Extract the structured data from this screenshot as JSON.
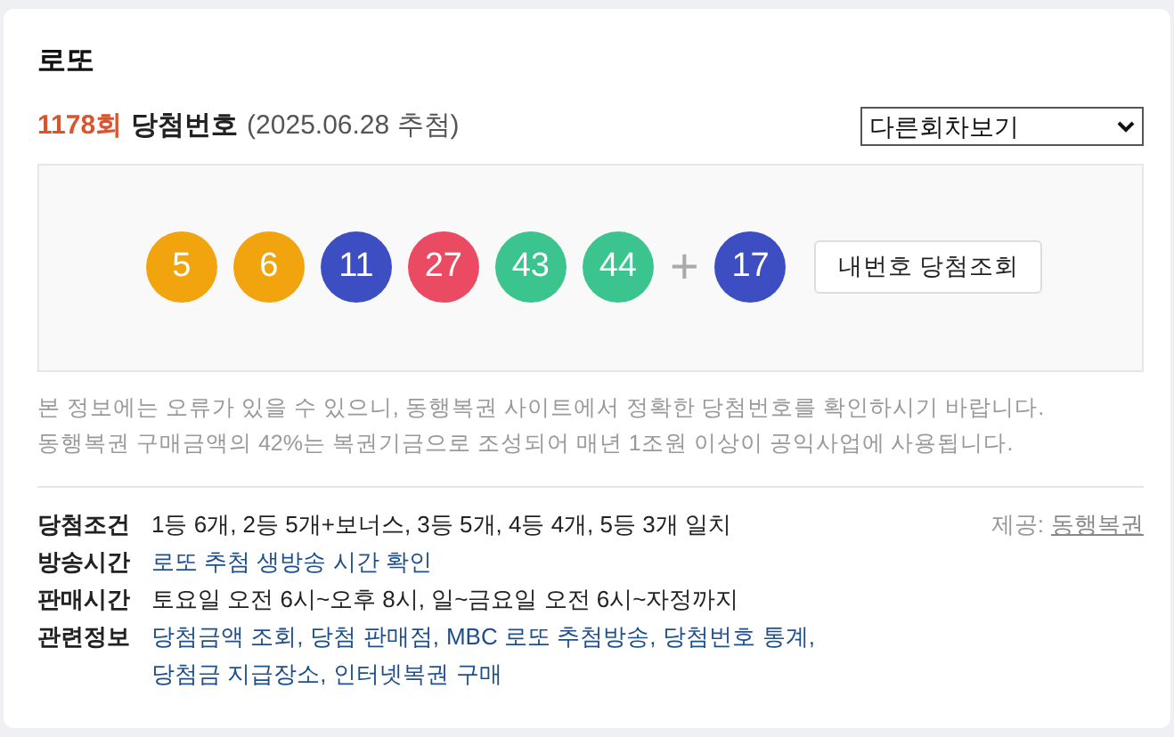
{
  "title": "로또",
  "draw": {
    "round": "1178회",
    "label": "당첨번호",
    "date": "(2025.06.28 추첨)"
  },
  "round_select": {
    "value": "다른회차보기"
  },
  "balls": [
    {
      "number": "5",
      "color": "#f2a40e",
      "kind": "main"
    },
    {
      "number": "6",
      "color": "#f2a40e",
      "kind": "main"
    },
    {
      "number": "11",
      "color": "#3c4ec2",
      "kind": "main"
    },
    {
      "number": "27",
      "color": "#ea4a62",
      "kind": "main"
    },
    {
      "number": "43",
      "color": "#3cc48f",
      "kind": "main"
    },
    {
      "number": "44",
      "color": "#3cc48f",
      "kind": "main"
    },
    {
      "number": "+",
      "kind": "plus"
    },
    {
      "number": "17",
      "color": "#3c4ec2",
      "kind": "bonus"
    }
  ],
  "check_button": "내번호 당첨조회",
  "notice": [
    "본 정보에는 오류가 있을 수 있으니, 동행복권 사이트에서 정확한 당첨번호를 확인하시기 바랍니다.",
    "동행복권 구매금액의 42%는 복권기금으로 조성되어 매년 1조원 이상이 공익사업에 사용됩니다."
  ],
  "source": {
    "label": "제공:",
    "link": "동행복권"
  },
  "info": [
    {
      "label": "당첨조건",
      "kind": "text",
      "text": "1등 6개, 2등 5개+보너스, 3등 5개, 4등 4개, 5등 3개 일치"
    },
    {
      "label": "방송시간",
      "kind": "links",
      "links": [
        "로또 추첨 생방송 시간 확인"
      ]
    },
    {
      "label": "판매시간",
      "kind": "text",
      "text": "토요일 오전 6시~오후 8시, 일~금요일 오전 6시~자정까지"
    },
    {
      "label": "관련정보",
      "kind": "links",
      "links": [
        "당첨금액 조회,",
        "당첨 판매점,",
        "MBC 로또 추첨방송,",
        "당첨번호 통계,",
        "당첨금 지급장소,",
        "인터넷복권 구매"
      ]
    }
  ]
}
